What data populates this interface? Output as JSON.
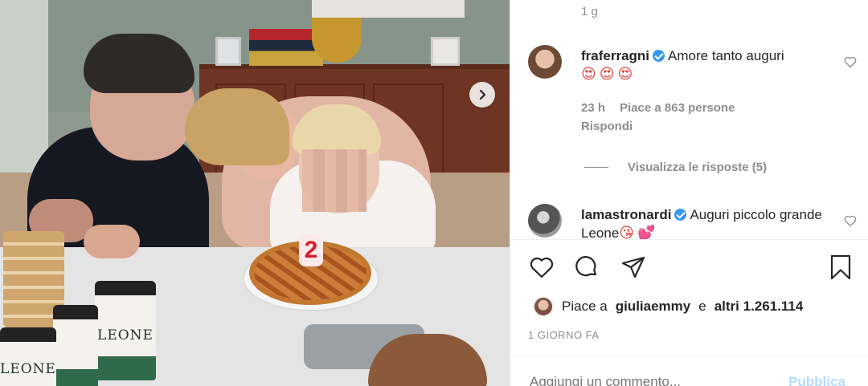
{
  "photo": {
    "candle_text": "2",
    "can_label": "LEONE",
    "can_label_partial": "LEONE"
  },
  "comments": {
    "truncated_text": "1 g",
    "items": [
      {
        "username": "fraferragni",
        "text": "Amore tanto auguri",
        "emoji": "😍😍😍",
        "time": "23 h",
        "likes": "Piace a 863 persone",
        "reply": "Rispondi",
        "view_replies": "Visualizza le risposte (5)"
      },
      {
        "username": "lamastronardi",
        "text": "Auguri piccolo grande Leone",
        "emoji": "😘💕"
      }
    ]
  },
  "likes": {
    "prefix": "Piace a",
    "user": "giuliaemmy",
    "conjunction": "e",
    "others": "altri 1.261.114"
  },
  "date": "1 GIORNO FA",
  "add_comment": {
    "placeholder": "Aggiungi un commento...",
    "publish": "Pubblica"
  },
  "colors": {
    "verified": "#3897f0",
    "publish_disabled": "#b3dbff",
    "secondary_text": "#8e8e8e"
  }
}
